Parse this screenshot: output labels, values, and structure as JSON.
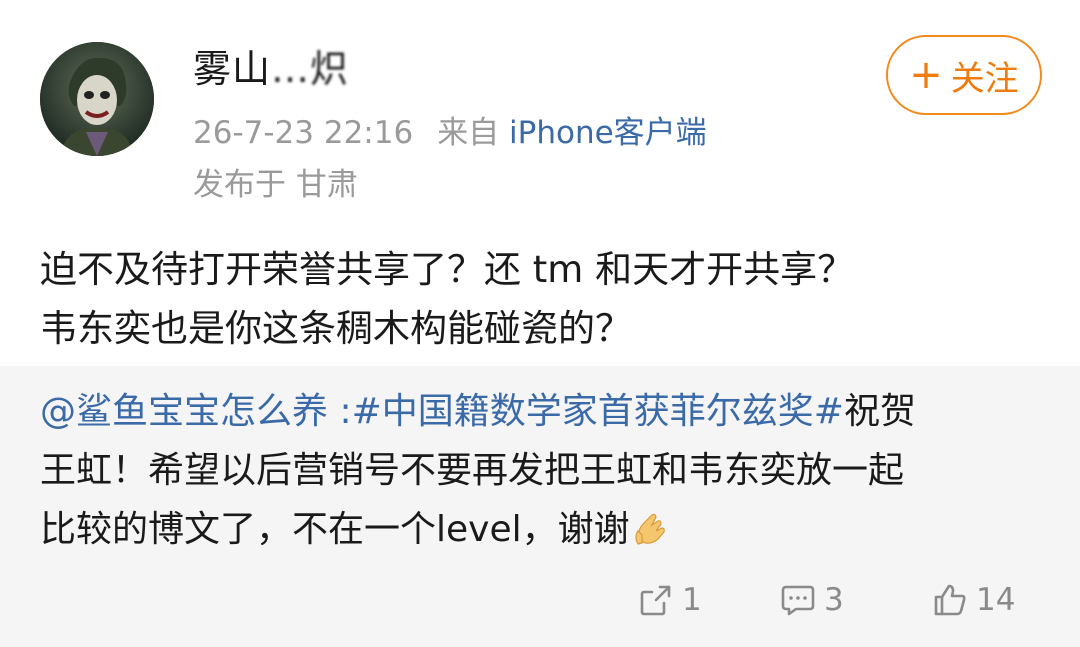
{
  "post": {
    "author": {
      "name_visible": "雾山",
      "name_obscured": "…炽"
    },
    "follow_label": "关注",
    "follow_icon": "plus-icon",
    "timestamp": "26-7-23 22:16",
    "source_prefix": "来自",
    "source_client": "iPhone客户端",
    "location": "发布于 甘肃",
    "text_lines": [
      "迫不及待打开荣誉共享了？还 tm 和天才开共享？",
      "韦东奕也是你这条稠木构能碰瓷的？"
    ]
  },
  "repost": {
    "mention": "@鲨鱼宝宝怎么养",
    "separator": " :",
    "hashtag1": "#中国籍数学家首获菲尔兹奖#",
    "hashtag2_part1": "祝贺",
    "line2": "王虹！希望以后营销号不要再发把王虹和韦东奕放一起",
    "line3": "比较的博文了，不在一个level，谢谢",
    "emoji": "folded-hands-emoji"
  },
  "actions": {
    "repost": {
      "icon": "repost-icon",
      "count": "1"
    },
    "comment": {
      "icon": "comment-icon",
      "count": "3"
    },
    "like": {
      "icon": "thumbs-up-icon",
      "count": "14"
    }
  },
  "colors": {
    "accent_orange": "#f07c10",
    "link_blue": "#3b6aa8",
    "meta_gray": "#9a9a9a",
    "repost_bg": "#f5f5f5"
  }
}
